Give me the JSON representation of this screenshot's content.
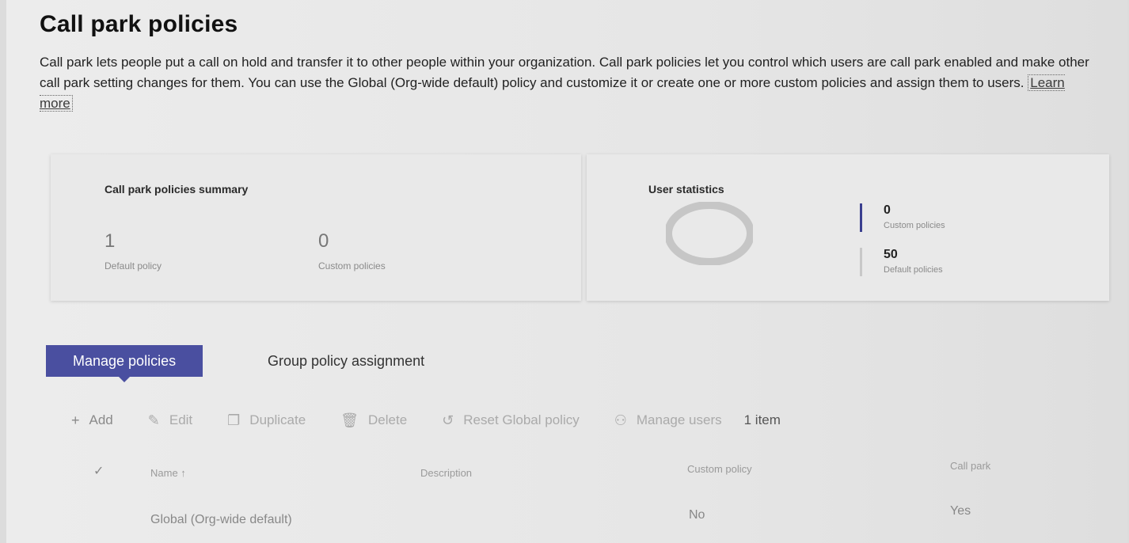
{
  "page": {
    "title": "Call park policies",
    "description": "Call park lets people put a call on hold and transfer it to other people within your organization. Call park policies let you control which users are call park enabled and make other call park setting changes for them. You can use the Global (Org-wide default) policy and customize it or create one or more custom policies and assign them to users.",
    "learn_more": "Learn more"
  },
  "summary": {
    "title": "Call park policies summary",
    "default_count": "1",
    "default_label": "Default policy",
    "custom_count": "0",
    "custom_label": "Custom policies"
  },
  "user_stats": {
    "title": "User statistics",
    "items": [
      {
        "value": "0",
        "label": "Custom policies",
        "color": "#3a3f8f"
      },
      {
        "value": "50",
        "label": "Default policies",
        "color": "#c8c8c8"
      }
    ]
  },
  "tabs": [
    {
      "label": "Manage policies",
      "active": true
    },
    {
      "label": "Group policy assignment",
      "active": false
    }
  ],
  "toolbar": {
    "add": "Add",
    "edit": "Edit",
    "duplicate": "Duplicate",
    "delete": "Delete",
    "reset": "Reset Global policy",
    "manage_users": "Manage users",
    "count": "1 item",
    "icons": {
      "add": "plus-icon",
      "edit": "pencil-icon",
      "duplicate": "copy-icon",
      "delete": "trash-icon",
      "reset": "reset-icon",
      "manage_users": "people-icon"
    }
  },
  "table": {
    "columns": [
      "Name ↑",
      "Description",
      "Custom policy",
      "Call park"
    ],
    "rows": [
      {
        "name": "Global (Org-wide default)",
        "description": "",
        "custom_policy": "No",
        "call_park": "Yes"
      }
    ]
  }
}
